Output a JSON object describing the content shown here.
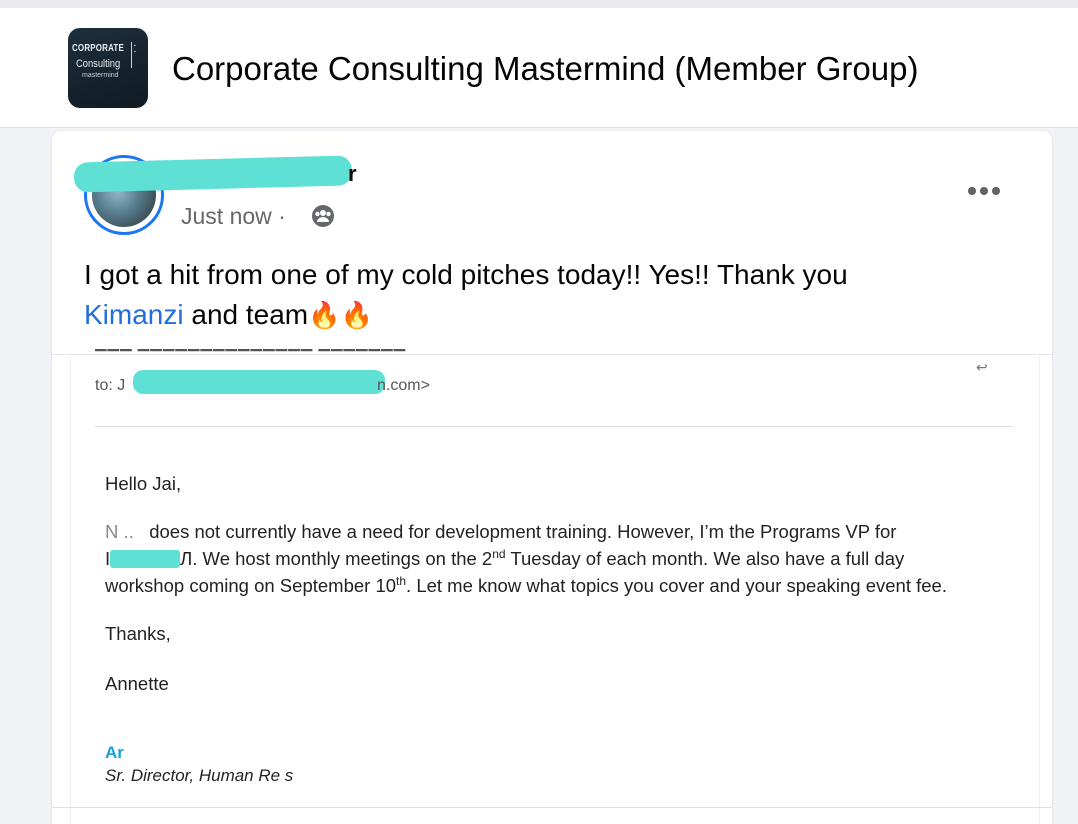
{
  "group": {
    "logo_line1": "CORPORATE",
    "logo_line2": "Consulting",
    "logo_line3": "mastermind",
    "title": "Corporate Consulting Mastermind (Member Group)"
  },
  "post": {
    "author_fragment": "r",
    "time": "Just now ·",
    "text_part1": "I got a hit from one of my cold pitches today!! Yes!! Thank you",
    "mention": "Kimanzi",
    "text_part2": "and team",
    "emojis": "🔥🔥"
  },
  "email": {
    "to_label": "to: J",
    "to_tail": "n.com>",
    "greeting": "Hello Jai,",
    "line1_start": "N  ..",
    "line1_rest": "does not currently have a need for development training.  However, I’m the Programs VP for",
    "line2_start": "I",
    "line2_rest": "Л.  We host monthly meetings on the 2",
    "line2_sup": "nd",
    "line2_end": " Tuesday of each month.  We also have a full day",
    "line3_start": "workshop coming on September 10",
    "line3_sup": "th",
    "line3_end": ".  Let me know what topics you cover and your speaking event fee.",
    "thanks": "Thanks,",
    "signoff": "Annette",
    "sig_name": "Ar",
    "sig_title": "Sr. Director, Human Re        s"
  },
  "colors": {
    "facebook_blue": "#1877f2",
    "mention_blue": "#216fdb",
    "redaction": "#5fe0d4"
  },
  "icons": {
    "audience": "group-audience-icon",
    "more": "more-options-icon"
  }
}
